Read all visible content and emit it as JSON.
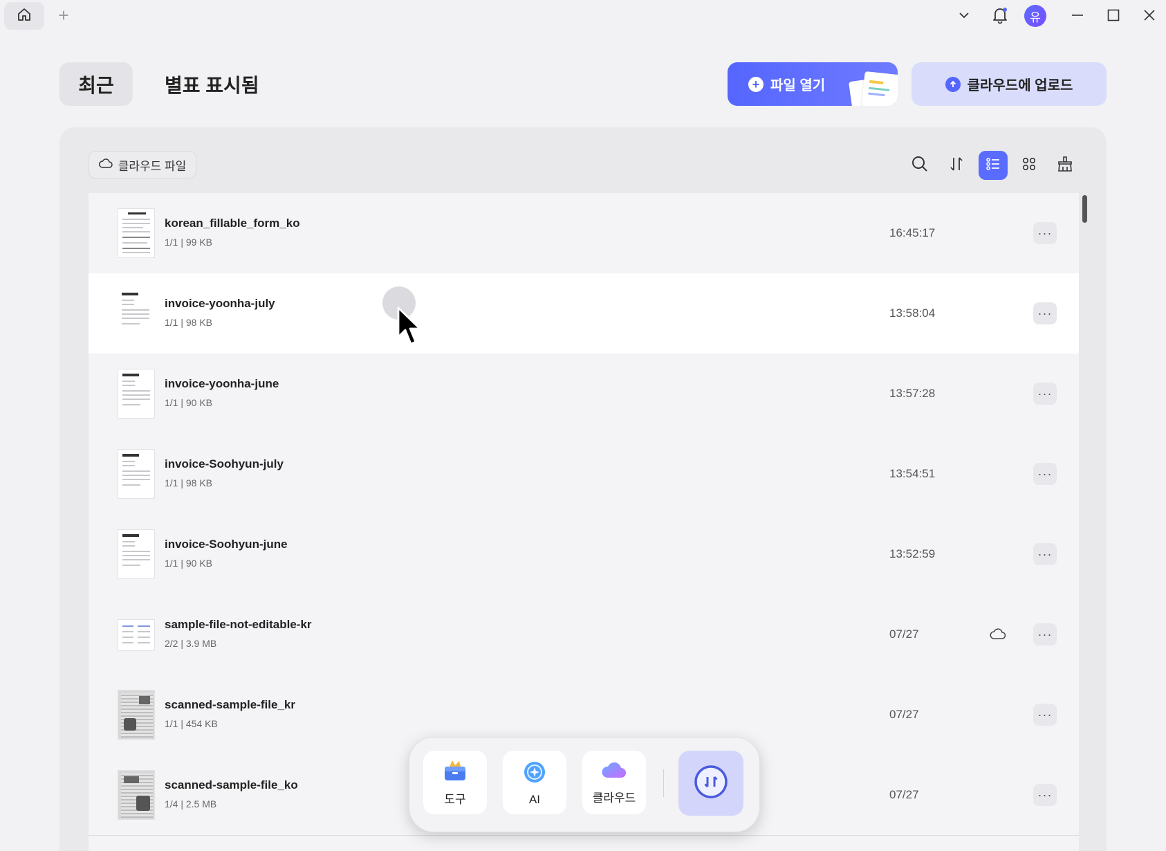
{
  "titlebar": {
    "new_tab": "+",
    "avatar_initial": "유"
  },
  "header": {
    "tab_recent": "최근",
    "tab_starred": "별표 표시됨",
    "open_file": "파일 열기",
    "upload_cloud": "클라우드에 업로드"
  },
  "toolbar": {
    "cloud_files": "클라우드 파일"
  },
  "files": [
    {
      "name": "korean_fillable_form_ko",
      "meta": "1/1 | 99 KB",
      "time": "16:45:17",
      "cloud": false,
      "thumb": "form"
    },
    {
      "name": "invoice-yoonha-july",
      "meta": "1/1 | 98 KB",
      "time": "13:58:04",
      "cloud": false,
      "thumb": "invoice"
    },
    {
      "name": "invoice-yoonha-june",
      "meta": "1/1 | 90 KB",
      "time": "13:57:28",
      "cloud": false,
      "thumb": "invoice"
    },
    {
      "name": "invoice-Soohyun-july",
      "meta": "1/1 | 98 KB",
      "time": "13:54:51",
      "cloud": false,
      "thumb": "invoice"
    },
    {
      "name": "invoice-Soohyun-june",
      "meta": "1/1 | 90 KB",
      "time": "13:52:59",
      "cloud": false,
      "thumb": "invoice"
    },
    {
      "name": "sample-file-not-editable-kr",
      "meta": "2/2 | 3.9 MB",
      "time": "07/27",
      "cloud": true,
      "thumb": "wide"
    },
    {
      "name": "scanned-sample-file_kr",
      "meta": "1/1 | 454 KB",
      "time": "07/27",
      "cloud": false,
      "thumb": "scan"
    },
    {
      "name": "scanned-sample-file_ko",
      "meta": "1/4 | 2.5 MB",
      "time": "07/27",
      "cloud": false,
      "thumb": "scan"
    }
  ],
  "dock": {
    "tools": "도구",
    "ai": "AI",
    "cloud": "클라우드"
  },
  "colors": {
    "accent": "#5566ff",
    "accent_light": "#d9dcfb"
  }
}
